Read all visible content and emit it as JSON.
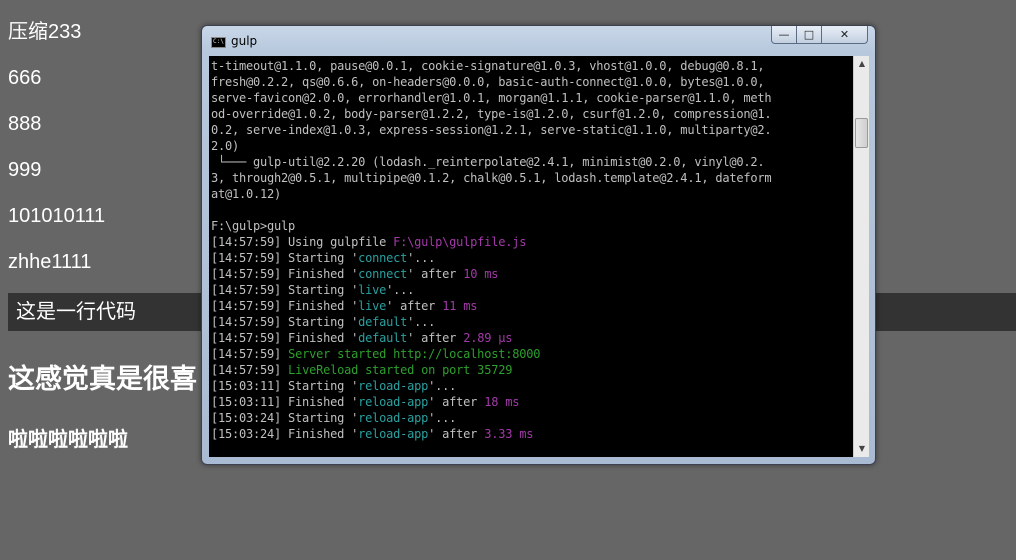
{
  "page": {
    "lines": [
      "压缩233",
      "666",
      "888",
      "999",
      "101010111",
      "zhhe1111"
    ],
    "code_line": "这是一行代码",
    "heading": "这感觉真是很喜",
    "subheading": "啦啦啦啦啦啦"
  },
  "window": {
    "title": "gulp",
    "icon": "console-icon",
    "controls": {
      "minimize": "—",
      "maximize": "□",
      "close": "✕"
    }
  },
  "console": {
    "colors": {
      "default": "#c0c0c0",
      "magenta": "#a23aa8",
      "cyan": "#2aa0a0",
      "green": "#2e9f2e"
    },
    "lines": [
      [
        {
          "t": "t-timeout@1.1.0, pause@0.0.1, cookie-signature@1.0.3, vhost@1.0.0, debug@0.8.1,",
          "c": "w"
        }
      ],
      [
        {
          "t": "fresh@0.2.2, qs@0.6.6, on-headers@0.0.0, basic-auth-connect@1.0.0, bytes@1.0.0,",
          "c": "w"
        }
      ],
      [
        {
          "t": "serve-favicon@2.0.0, errorhandler@1.0.1, morgan@1.1.1, cookie-parser@1.1.0, meth",
          "c": "w"
        }
      ],
      [
        {
          "t": "od-override@1.0.2, body-parser@1.2.2, type-is@1.2.0, csurf@1.2.0, compression@1.",
          "c": "w"
        }
      ],
      [
        {
          "t": "0.2, serve-index@1.0.3, express-session@1.2.1, serve-static@1.1.0, multiparty@2.",
          "c": "w"
        }
      ],
      [
        {
          "t": "2.0)",
          "c": "w"
        }
      ],
      [
        {
          "t": " └─── gulp-util@2.2.20 (lodash._reinterpolate@2.4.1, minimist@0.2.0, vinyl@0.2.",
          "c": "w"
        }
      ],
      [
        {
          "t": "3, through2@0.5.1, multipipe@0.1.2, chalk@0.5.1, lodash.template@2.4.1, dateform",
          "c": "w"
        }
      ],
      [
        {
          "t": "at@1.0.12)",
          "c": "w"
        }
      ],
      [
        {
          "t": "",
          "c": "w"
        }
      ],
      [
        {
          "t": "F:\\gulp>gulp",
          "c": "w"
        }
      ],
      [
        {
          "t": "[14:57:59] Using gulpfile ",
          "c": "w"
        },
        {
          "t": "F:\\gulp\\gulpfile.js",
          "c": "m"
        }
      ],
      [
        {
          "t": "[14:57:59] Starting '",
          "c": "w"
        },
        {
          "t": "connect",
          "c": "c"
        },
        {
          "t": "'...",
          "c": "w"
        }
      ],
      [
        {
          "t": "[14:57:59] Finished '",
          "c": "w"
        },
        {
          "t": "connect",
          "c": "c"
        },
        {
          "t": "' after ",
          "c": "w"
        },
        {
          "t": "10 ms",
          "c": "m"
        }
      ],
      [
        {
          "t": "[14:57:59] Starting '",
          "c": "w"
        },
        {
          "t": "live",
          "c": "c"
        },
        {
          "t": "'...",
          "c": "w"
        }
      ],
      [
        {
          "t": "[14:57:59] Finished '",
          "c": "w"
        },
        {
          "t": "live",
          "c": "c"
        },
        {
          "t": "' after ",
          "c": "w"
        },
        {
          "t": "11 ms",
          "c": "m"
        }
      ],
      [
        {
          "t": "[14:57:59] Starting '",
          "c": "w"
        },
        {
          "t": "default",
          "c": "c"
        },
        {
          "t": "'...",
          "c": "w"
        }
      ],
      [
        {
          "t": "[14:57:59] Finished '",
          "c": "w"
        },
        {
          "t": "default",
          "c": "c"
        },
        {
          "t": "' after ",
          "c": "w"
        },
        {
          "t": "2.89 μs",
          "c": "m"
        }
      ],
      [
        {
          "t": "[14:57:59] ",
          "c": "w"
        },
        {
          "t": "Server started http://localhost:8000",
          "c": "g"
        }
      ],
      [
        {
          "t": "[14:57:59] ",
          "c": "w"
        },
        {
          "t": "LiveReload started on port 35729",
          "c": "g"
        }
      ],
      [
        {
          "t": "[15:03:11] Starting '",
          "c": "w"
        },
        {
          "t": "reload-app",
          "c": "c"
        },
        {
          "t": "'...",
          "c": "w"
        }
      ],
      [
        {
          "t": "[15:03:11] Finished '",
          "c": "w"
        },
        {
          "t": "reload-app",
          "c": "c"
        },
        {
          "t": "' after ",
          "c": "w"
        },
        {
          "t": "18 ms",
          "c": "m"
        }
      ],
      [
        {
          "t": "[15:03:24] Starting '",
          "c": "w"
        },
        {
          "t": "reload-app",
          "c": "c"
        },
        {
          "t": "'...",
          "c": "w"
        }
      ],
      [
        {
          "t": "[15:03:24] Finished '",
          "c": "w"
        },
        {
          "t": "reload-app",
          "c": "c"
        },
        {
          "t": "' after ",
          "c": "w"
        },
        {
          "t": "3.33 ms",
          "c": "m"
        }
      ]
    ]
  },
  "scrollbar": {
    "up": "▲",
    "down": "▼"
  }
}
